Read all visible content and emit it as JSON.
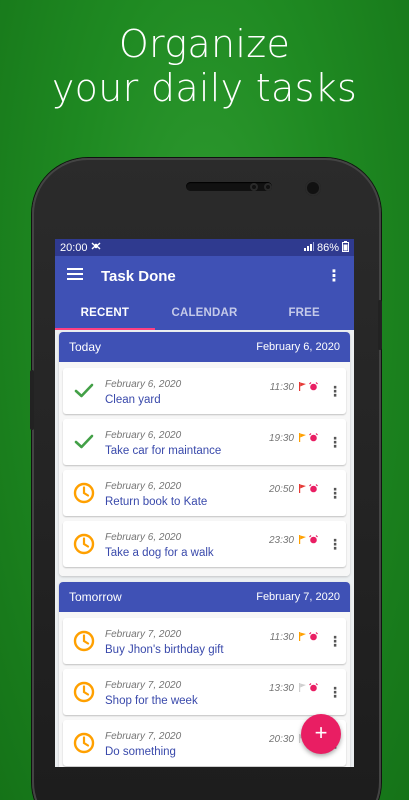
{
  "promo": {
    "line1": "Organize",
    "line2": "your daily tasks"
  },
  "status_bar": {
    "time": "20:00",
    "battery": "86%"
  },
  "app": {
    "title": "Task Done"
  },
  "tabs": [
    {
      "label": "RECENT",
      "active": true
    },
    {
      "label": "CALENDAR",
      "active": false
    },
    {
      "label": "FREE",
      "active": false
    }
  ],
  "sections": [
    {
      "title": "Today",
      "date": "February 6, 2020",
      "tasks": [
        {
          "date": "February 6, 2020",
          "name": "Clean yard",
          "time": "11:30",
          "status": "done",
          "flag_color": "#e53935"
        },
        {
          "date": "February 6, 2020",
          "name": "Take car for maintance",
          "time": "19:30",
          "status": "done",
          "flag_color": "#ffa000"
        },
        {
          "date": "February 6, 2020",
          "name": "Return book to Kate",
          "time": "20:50",
          "status": "pending",
          "flag_color": "#e53935"
        },
        {
          "date": "February 6, 2020",
          "name": "Take a dog for a walk",
          "time": "23:30",
          "status": "pending",
          "flag_color": "#ffa000"
        }
      ]
    },
    {
      "title": "Tomorrow",
      "date": "February 7, 2020",
      "tasks": [
        {
          "date": "February 7, 2020",
          "name": "Buy Jhon's birthday gift",
          "time": "11:30",
          "status": "pending",
          "flag_color": "#ffa000"
        },
        {
          "date": "February 7, 2020",
          "name": "Shop for the week",
          "time": "13:30",
          "status": "pending",
          "flag_color": "#cfcfcf"
        },
        {
          "date": "February 7, 2020",
          "name": "Do something",
          "time": "20:30",
          "status": "pending",
          "flag_color": "#cfcfcf"
        }
      ]
    }
  ],
  "colors": {
    "primary": "#3f51b5",
    "accent": "#e91e63",
    "done": "#43a047",
    "pending": "#ffa000",
    "alarm": "#e91e63"
  },
  "fab": {
    "label": "+"
  },
  "icons": {
    "menu": "hamburger-menu-icon",
    "overflow": "more-vert-icon",
    "done": "checkmark-icon",
    "pending": "clock-icon",
    "priority": "flag-icon",
    "reminder": "alarm-icon"
  }
}
